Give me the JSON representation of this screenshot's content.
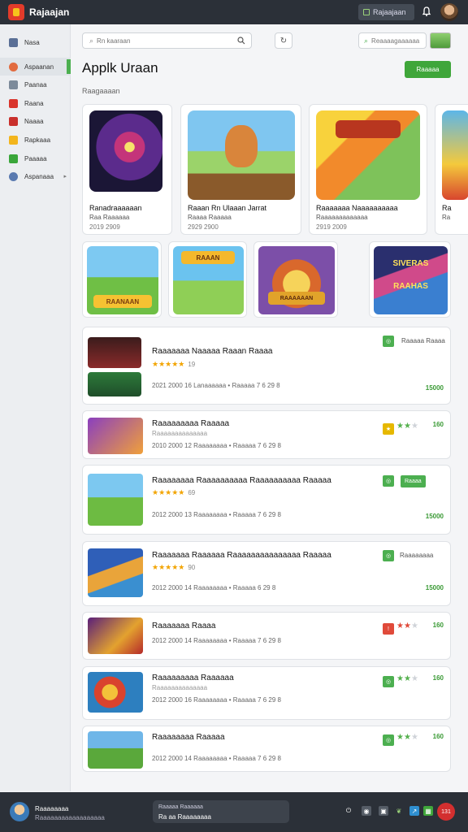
{
  "app": {
    "title": "Rajaajan"
  },
  "topbar": {
    "button_label": "Rajaajaan",
    "bell_icon": "bell-icon",
    "avatar": "avatar"
  },
  "sidebar": {
    "items": [
      {
        "label": "Nasa",
        "icon_color": "#5a6f96",
        "active": false
      },
      {
        "label": "Aspaanan",
        "icon_color": "#e26b3f",
        "active": true
      },
      {
        "label": "Paanaa",
        "icon_color": "#7c8a9a",
        "active": false
      },
      {
        "label": "Raana",
        "icon_color": "#d9342b",
        "active": false
      },
      {
        "label": "Naaaa",
        "icon_color": "#c9302c",
        "active": false
      },
      {
        "label": "Rapkaaa",
        "icon_color": "#f3b51d",
        "active": false
      },
      {
        "label": "Paaaaa",
        "icon_color": "#3aa63a",
        "active": false
      },
      {
        "label": "Aspanaaa",
        "icon_color": "#5a7ab0",
        "active": false
      }
    ]
  },
  "search": {
    "placeholder": "Rn kaaraan"
  },
  "search2": {
    "placeholder": "Reaaaagaaaaaa"
  },
  "page": {
    "title": "Applk Uraan",
    "primary_button": "Raaaaa",
    "section_label": "Raagaaaan"
  },
  "featured": [
    {
      "title": "Ranadraaaaaan",
      "sub": "Raa Raaaaaa",
      "date": "2019 2909"
    },
    {
      "title": "Raaan Rn Ulaaan Jarrat",
      "sub": "Raaaa Raaaaa",
      "date": "2929 2900"
    },
    {
      "title": "Raaaaaaa Naaaaaaaaaa",
      "sub": "Raaaaaaaaaaaaa",
      "date": "2919 2009"
    },
    {
      "title": "Ra",
      "sub": "Ra",
      "date": ""
    }
  ],
  "small_cards": [
    {
      "label": "RAANAAN"
    },
    {
      "label": "RAAAN"
    },
    {
      "label": "RAAAAAAN"
    },
    {
      "label": "SIVERAS RAAHAS"
    }
  ],
  "list": [
    {
      "title": "Raaaaaaa Naaaaa Raaan Raaaa",
      "sub": "",
      "stars": "★★★★★",
      "count": "19",
      "meta": "2021 2000 16  Lanaaaaaa  •  Raaaaa 7 6 29 8",
      "action": "Raaaaa Raaaa",
      "price": "15000",
      "badge_color": "#4caf50"
    },
    {
      "title": "Raaaaaaaaa Raaaaa",
      "sub": "Raaaaaaaaaaaaaa",
      "stars": "",
      "count": "",
      "meta": "2010 2000 12  Raaaaaaaa  •  Raaaaa 7 6 29 8",
      "action": "",
      "price": "160",
      "badge_color": "#e6b800"
    },
    {
      "title": "Raaaaaaaa Raaaaaaaaaa Raaaaaaaaaa Raaaaa",
      "sub": "",
      "stars": "★★★★★",
      "count": "69",
      "meta": "2012 2000 13  Raaaaaaaa  •  Raaaaa 7 6 29 8",
      "action": "Raaaa",
      "price": "15000",
      "badge_color": "#4caf50"
    },
    {
      "title": "Raaaaaaa Raaaaaa Raaaaaaaaaaaaaaa Raaaaa",
      "sub": "",
      "stars": "★★★★★",
      "count": "90",
      "meta": "2012 2000 14  Raaaaaaaa  •  Raaaaa 6 29 8",
      "action": "Raaaaaaaa",
      "price": "15000",
      "badge_color": "#4caf50"
    },
    {
      "title": "Raaaaaaa Raaaa",
      "sub": "",
      "stars": "",
      "count": "",
      "meta": "2012 2000 14  Raaaaaaaa  •  Raaaaa 7 6 29 8",
      "action": "",
      "price": "160",
      "badge_color": "#e04a3a"
    },
    {
      "title": "Raaaaaaaaa Raaaaaa",
      "sub": "Raaaaaaaaaaaaaa",
      "stars": "",
      "count": "",
      "meta": "2012 2000 16  Raaaaaaaa  •  Raaaaa 7 6 29 8",
      "action": "",
      "price": "160",
      "badge_color": "#4caf50"
    },
    {
      "title": "Raaaaaaaa Raaaaa",
      "sub": "",
      "stars": "",
      "count": "",
      "meta": "2012 2000 14  Raaaaaaaa  •  Raaaaa 7 6 29 8",
      "action": "",
      "price": "160",
      "badge_color": "#4caf50"
    }
  ],
  "bottombar": {
    "name": "Raaaaaaaa",
    "sub": "Raaaaaaaaaaaaaaaaaa",
    "np_line1": "Raaaaa Raaaaaa",
    "np_line2": "Ra aa Raaaaaaaa",
    "rec_label": "131"
  }
}
